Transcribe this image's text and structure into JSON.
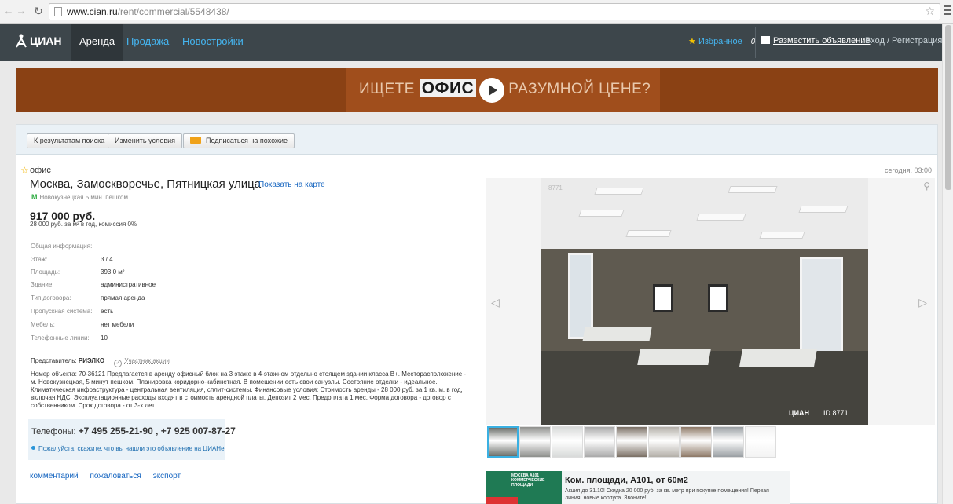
{
  "browser": {
    "url_host": "www.cian.ru",
    "url_path": "/rent/commercial/5548438/"
  },
  "header": {
    "logo_text": "ЦИАН",
    "tabs": [
      {
        "label": "Аренда",
        "active": true
      },
      {
        "label": "Продажа",
        "active": false
      },
      {
        "label": "Новостройки",
        "active": false
      }
    ],
    "favorites_label": "Избранное",
    "favorites_count": "0",
    "post_ad_label": "Разместить объявление",
    "login_label": "Вход / Регистрация"
  },
  "banner": {
    "text_left": "ИЩЕТЕ ",
    "text_bold": "ОФИС",
    "text_right": " ПО РАЗУМНОЙ ЦЕНЕ?"
  },
  "toolbar": {
    "back_label": "К результатам поиска",
    "change_label": "Изменить условия",
    "subscribe_label": "Подписаться на похожие"
  },
  "listing": {
    "type": "офис",
    "date": "сегодня, 03:00",
    "address": "Москва, Замоскворечье, Пятницкая улица",
    "map_link": "Показать на карте",
    "metro": "Новокузнецкая 5 мин. пешком",
    "price": "917 000 руб.",
    "price_sub": "28 000 руб. за м² в год, комиссия 0%",
    "info_title": "Общая информация:",
    "info": [
      {
        "k": "Этаж:",
        "v": "3 / 4"
      },
      {
        "k": "Площадь:",
        "v": "393,0 м²"
      },
      {
        "k": "Здание:",
        "v": "административное"
      },
      {
        "k": "Тип договора:",
        "v": "прямая аренда"
      },
      {
        "k": "Пропускная система:",
        "v": "есть"
      },
      {
        "k": "Мебель:",
        "v": "нет мебели"
      },
      {
        "k": "Телефонные линии:",
        "v": "10"
      }
    ],
    "rep_label": "Представитель: ",
    "rep_name": "РИЭЛКО",
    "rep_badge": "Участник акции",
    "description": "Номер объекта: 70-36121 Предлагается в аренду офисный блок на 3 этаже в 4-этажном отдельно стоящем здании класса B+. Месторасположение - м. Новокузнецкая, 5 минут пешком. Планировка коридорно-кабинетная. В помещении есть свои санузлы. Состояние отделки - идеальное. Климатическая инфраструктура - центральная вентиляция, сплит-системы. Финансовые условия: Стоимость аренды - 28 000 руб. за 1 кв. м. в год, включая НДС. Эксплуатационные расходы входят в стоимость арендной платы. Депозит 2 мес. Предоплата 1 мес. Форма договора - договор с собственником. Срок договора - от 3-х лет.",
    "phones_label": "Телефоны: ",
    "phones": "+7 495 255-21-90 , +7 925 007-87-27",
    "ask_text": "Пожалуйста, скажите, что вы нашли это объявление на ЦИАНе",
    "links": [
      "комментарий",
      "пожаловаться",
      "экспорт"
    ]
  },
  "gallery": {
    "photo_id_tl": "8771",
    "watermark_logo": "ЦИАН",
    "watermark_id": "ID 8771",
    "thumb_colors": [
      "#6b6f6a",
      "#8e8f8c",
      "#d8dad9",
      "#a9a9a9",
      "#7a6f64",
      "#b3afa8",
      "#8d7866",
      "#9a9fa3",
      "#f3f3f3"
    ]
  },
  "ad": {
    "image_label": "МОСКВА А101 КОММЕРЧЕСКИЕ ПЛОЩАДИ",
    "title": "Ком. площади, А101, от 60м2",
    "text": "Акция до 31.10! Скидка 20 000 руб. за кв. метр при покупке помещения! Первая линия, новые корпуса. Звоните!"
  },
  "colors": {
    "header_bg": "#3d464b",
    "link": "#1565c0",
    "accent": "#45b5f0",
    "banner": "#8a4114"
  }
}
